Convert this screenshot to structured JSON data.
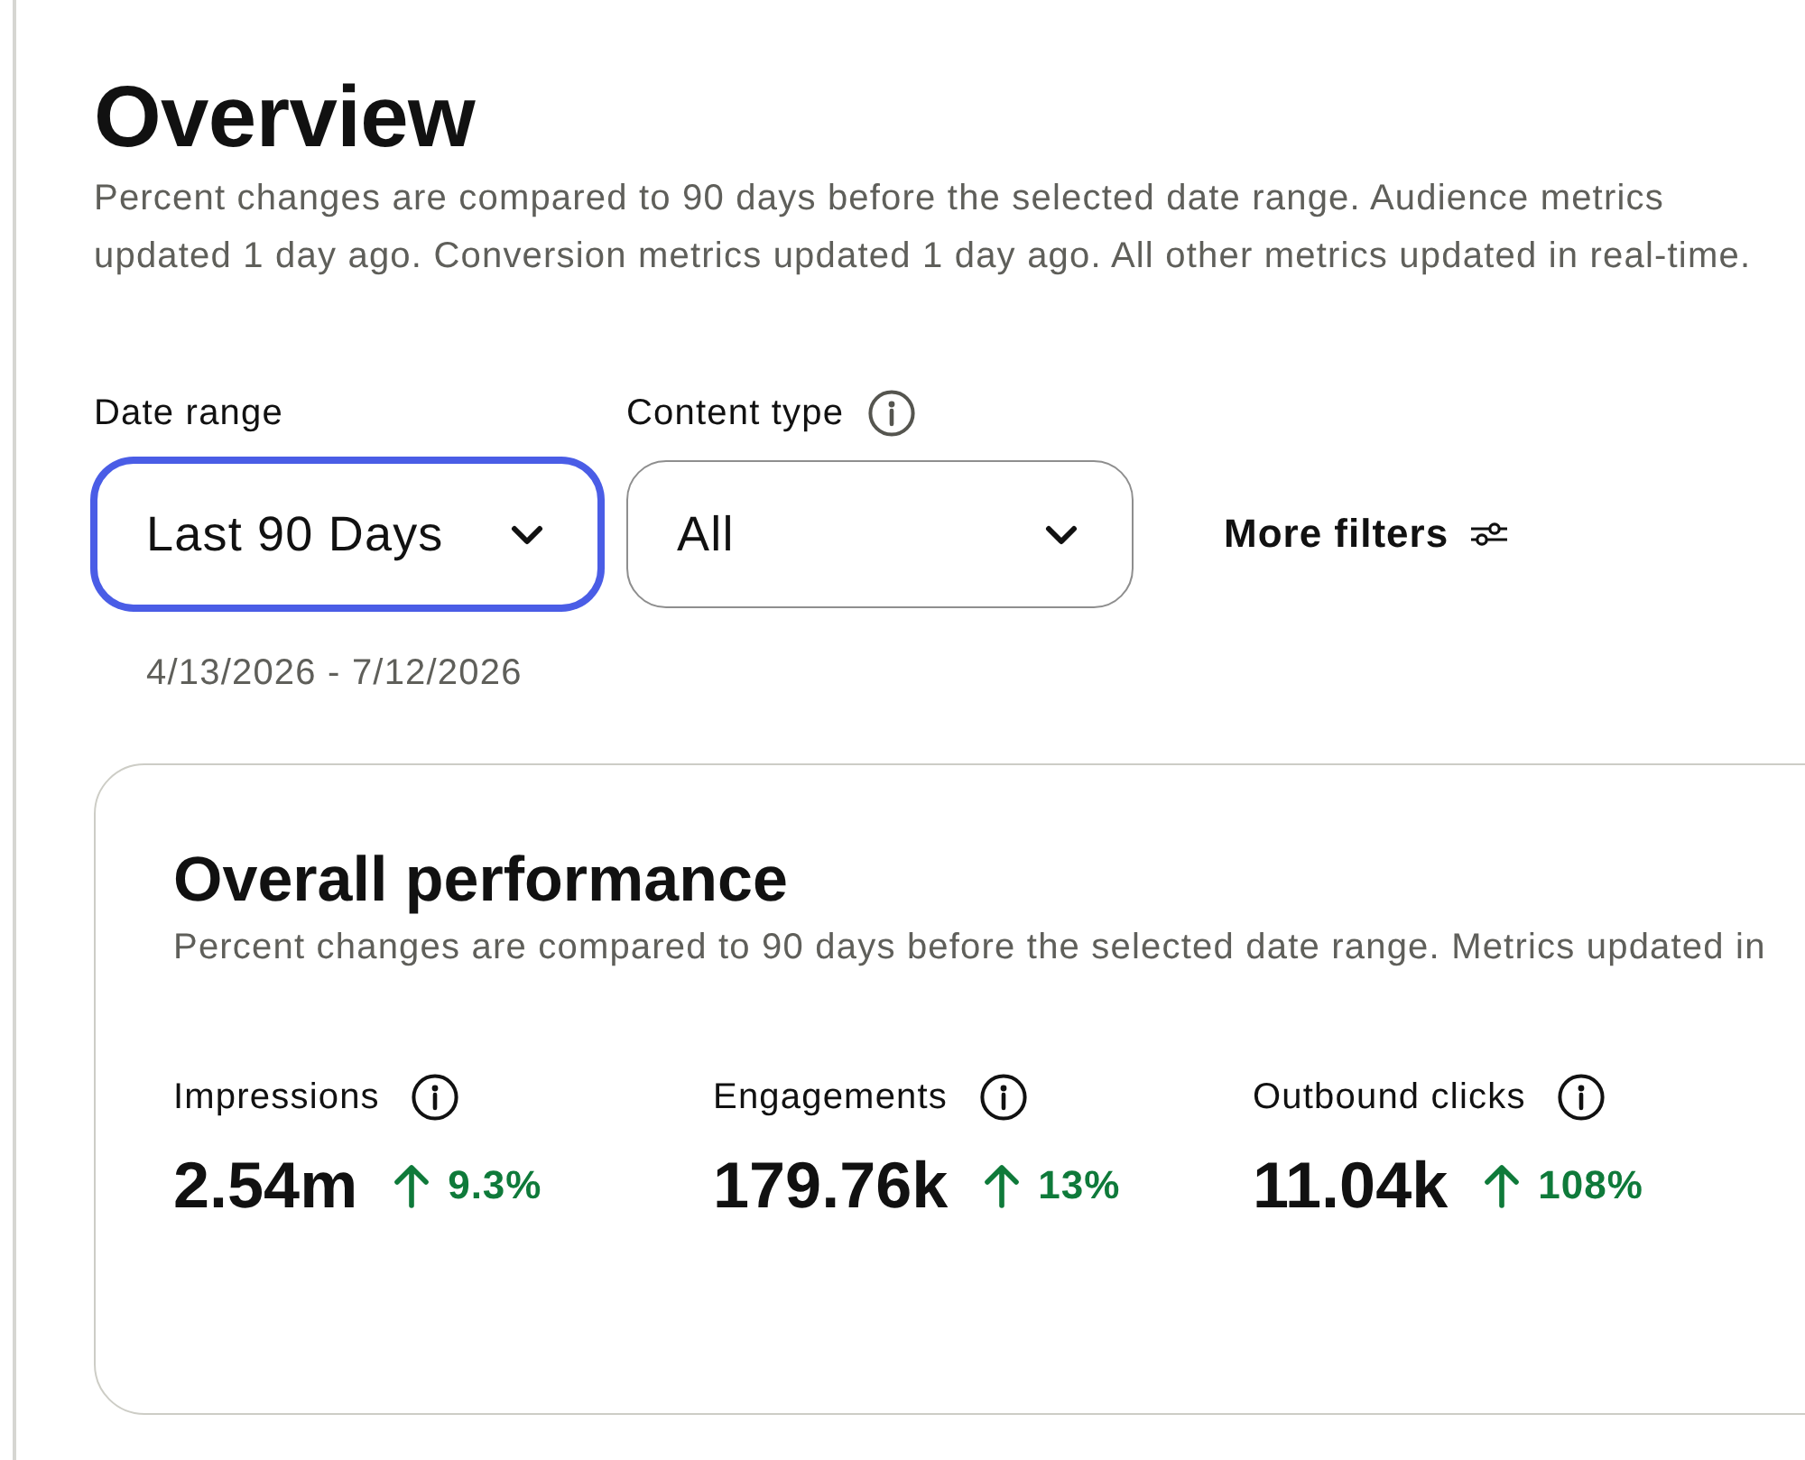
{
  "header": {
    "title": "Overview",
    "description": "Percent changes are compared to 90 days before the selected date range. Audience metrics updated 1 day ago. Conversion metrics updated 1 day ago. All other metrics updated in real-time."
  },
  "filters": [
    {
      "kind": "dropdown",
      "label": "Date range",
      "info": false,
      "value": "Last 90 Days",
      "focused": true,
      "hint": "4/13/2026 - 7/12/2026"
    },
    {
      "kind": "dropdown",
      "label": "Content type",
      "info": true,
      "value": "All",
      "focused": false
    },
    {
      "kind": "button",
      "label": "More filters"
    }
  ],
  "performance": {
    "title": "Overall performance",
    "description": "Percent changes are compared to 90 days before the selected date range. Metrics updated in",
    "metrics": [
      {
        "label": "Impressions",
        "value": "2.54m",
        "increase": true,
        "change": "9.3%"
      },
      {
        "label": "Engagements",
        "value": "179.76k",
        "increase": true,
        "change": "13%"
      },
      {
        "label": "Outbound clicks",
        "value": "11.04k",
        "increase": true,
        "change": "108%"
      }
    ]
  }
}
